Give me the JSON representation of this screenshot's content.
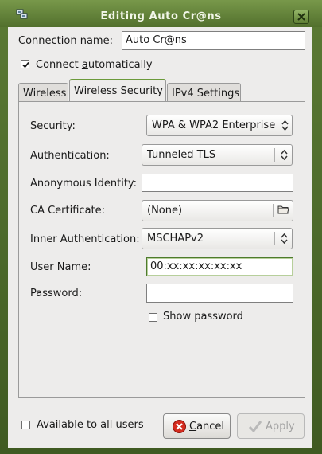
{
  "window": {
    "title": "Editing Auto Cr@ns"
  },
  "connection": {
    "name_label_pre": "Connection ",
    "name_label_u": "n",
    "name_label_post": "ame:",
    "name_value": "Auto Cr@ns",
    "auto_pre": "Connect ",
    "auto_u": "a",
    "auto_post": "utomatically",
    "auto_checked": true
  },
  "tabs": [
    {
      "label": "Wireless"
    },
    {
      "label": "Wireless Security",
      "active": true
    },
    {
      "label": "IPv4 Settings"
    }
  ],
  "security": {
    "security_label": "Security:",
    "security_value": "WPA & WPA2 Enterprise",
    "authentication_label": "Authentication:",
    "authentication_value": "Tunneled TLS",
    "anon_label": "Anonymous Identity:",
    "anon_value": "",
    "ca_label": "CA Certificate:",
    "ca_value": "(None)",
    "inner_label": "Inner Authentication:",
    "inner_value": "MSCHAPv2",
    "username_label": "User Name:",
    "username_value": "00:xx:xx:xx:xx:xx",
    "password_label": "Password:",
    "password_value": "",
    "show_password_label": "Show password",
    "show_password_checked": false
  },
  "footer": {
    "available_label": "Available to all users",
    "available_checked": false,
    "cancel_u": "C",
    "cancel_rest": "ancel",
    "apply_label": "Apply"
  },
  "colors": {
    "titlebar": "#6a8b3c",
    "focus": "#4e7b2d",
    "cancel_icon": "#d42b1e"
  }
}
